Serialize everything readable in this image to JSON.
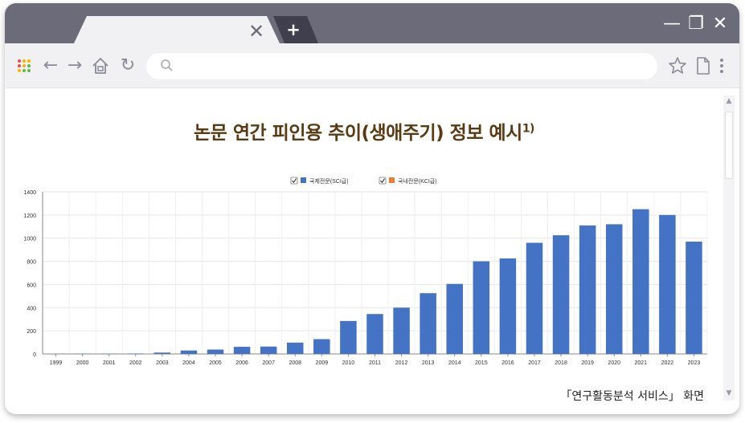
{
  "browser": {
    "tab_close_glyph": "✕",
    "new_tab_glyph": "+",
    "minimize_glyph": "—",
    "maximize_glyph": "❐",
    "close_glyph": "✕",
    "back_glyph": "←",
    "forward_glyph": "→",
    "reload_glyph": "↻",
    "address_value": "",
    "icons": [
      "apps-icon",
      "back-icon",
      "forward-icon",
      "home-icon",
      "reload-icon",
      "search-icon",
      "star-icon",
      "page-icon",
      "more-icon"
    ]
  },
  "page": {
    "title": "논문 연간 피인용 추이(생애주기) 정보 예시",
    "title_sup": "1)",
    "caption": "「연구활동분석 서비스」 화면"
  },
  "chart_data": {
    "type": "bar",
    "categories": [
      "1999",
      "2000",
      "2001",
      "2002",
      "2003",
      "2004",
      "2005",
      "2006",
      "2007",
      "2008",
      "2009",
      "2010",
      "2011",
      "2012",
      "2013",
      "2014",
      "2015",
      "2016",
      "2017",
      "2018",
      "2019",
      "2020",
      "2021",
      "2022",
      "2023"
    ],
    "series": [
      {
        "name": "국제전문(SCI급)",
        "color": "#4472c4",
        "values": [
          1,
          2,
          2,
          4,
          12,
          30,
          38,
          62,
          64,
          98,
          128,
          285,
          345,
          400,
          525,
          605,
          800,
          825,
          960,
          1025,
          1110,
          1120,
          1250,
          1200,
          970
        ]
      },
      {
        "name": "국내전문(KCI급)",
        "color": "#ed7d31",
        "values": [
          0,
          0,
          0,
          0,
          0,
          0,
          0,
          0,
          0,
          0,
          0,
          0,
          0,
          0,
          0,
          0,
          0,
          0,
          0,
          0,
          0,
          0,
          0,
          0,
          0
        ]
      }
    ],
    "yticks": [
      "0",
      "200",
      "400",
      "600",
      "800",
      "1000",
      "1200",
      "1400"
    ],
    "ylim": [
      0,
      1400
    ],
    "grid": true,
    "legend": "top-center",
    "legend_checked": [
      true,
      true
    ]
  }
}
